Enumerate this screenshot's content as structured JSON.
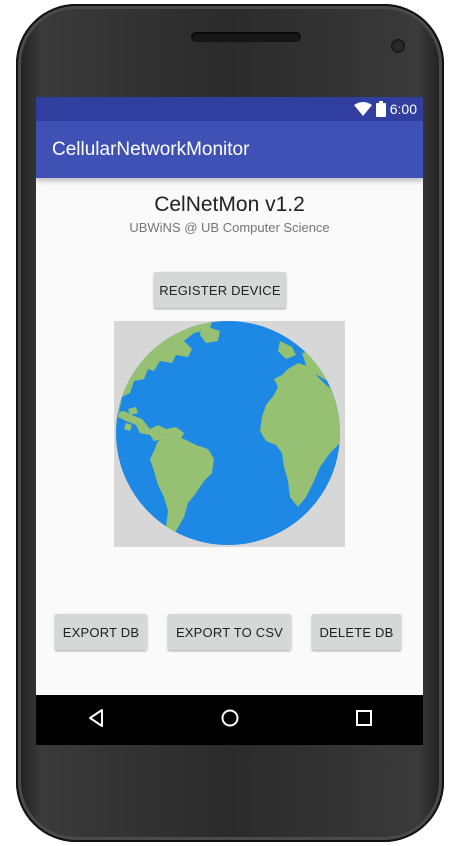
{
  "statusbar": {
    "time": "6:00"
  },
  "appbar": {
    "title": "CellularNetworkMonitor"
  },
  "main": {
    "title": "CelNetMon v1.2",
    "subtitle": "UBWiNS @ UB Computer Science",
    "register_label": "REGISTER DEVICE",
    "export_db_label": "EXPORT DB",
    "export_csv_label": "EXPORT TO CSV",
    "delete_db_label": "DELETE DB"
  },
  "colors": {
    "status_bar": "#303f9f",
    "app_bar": "#3f51b5",
    "ocean": "#1e88e5",
    "land": "#96c173"
  },
  "icons": [
    "wifi-icon",
    "battery-icon",
    "globe-icon",
    "back-icon",
    "home-icon",
    "recents-icon"
  ]
}
